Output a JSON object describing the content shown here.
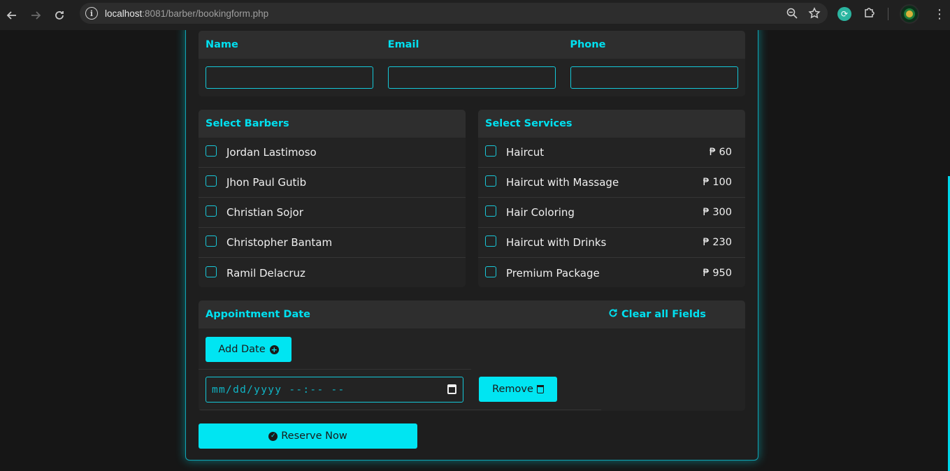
{
  "browser": {
    "url_host": "localhost",
    "url_rest": ":8081/barber/bookingform.php"
  },
  "contact": {
    "name_label": "Name",
    "email_label": "Email",
    "phone_label": "Phone",
    "name_value": "",
    "email_value": "",
    "phone_value": ""
  },
  "barbers": {
    "title": "Select Barbers",
    "items": [
      {
        "label": "Jordan Lastimoso"
      },
      {
        "label": "Jhon Paul Gutib"
      },
      {
        "label": "Christian Sojor"
      },
      {
        "label": "Christopher Bantam"
      },
      {
        "label": "Ramil Delacruz"
      }
    ]
  },
  "services": {
    "title": "Select Services",
    "items": [
      {
        "label": "Haircut",
        "price": "₱ 60"
      },
      {
        "label": "Haircut with Massage",
        "price": "₱ 100"
      },
      {
        "label": "Hair Coloring",
        "price": "₱ 300"
      },
      {
        "label": "Haircut with Drinks",
        "price": "₱ 230"
      },
      {
        "label": "Premium Package",
        "price": "₱ 950"
      }
    ]
  },
  "appointment": {
    "title": "Appointment Date",
    "clear_label": "Clear all Fields",
    "add_date_label": "Add Date",
    "date_placeholder": "mm/dd/yyyy --:-- --",
    "remove_label": "Remove"
  },
  "reserve_label": "Reserve Now",
  "colors": {
    "accent": "#00e5f2",
    "background": "#161616",
    "panel": "#232323"
  }
}
